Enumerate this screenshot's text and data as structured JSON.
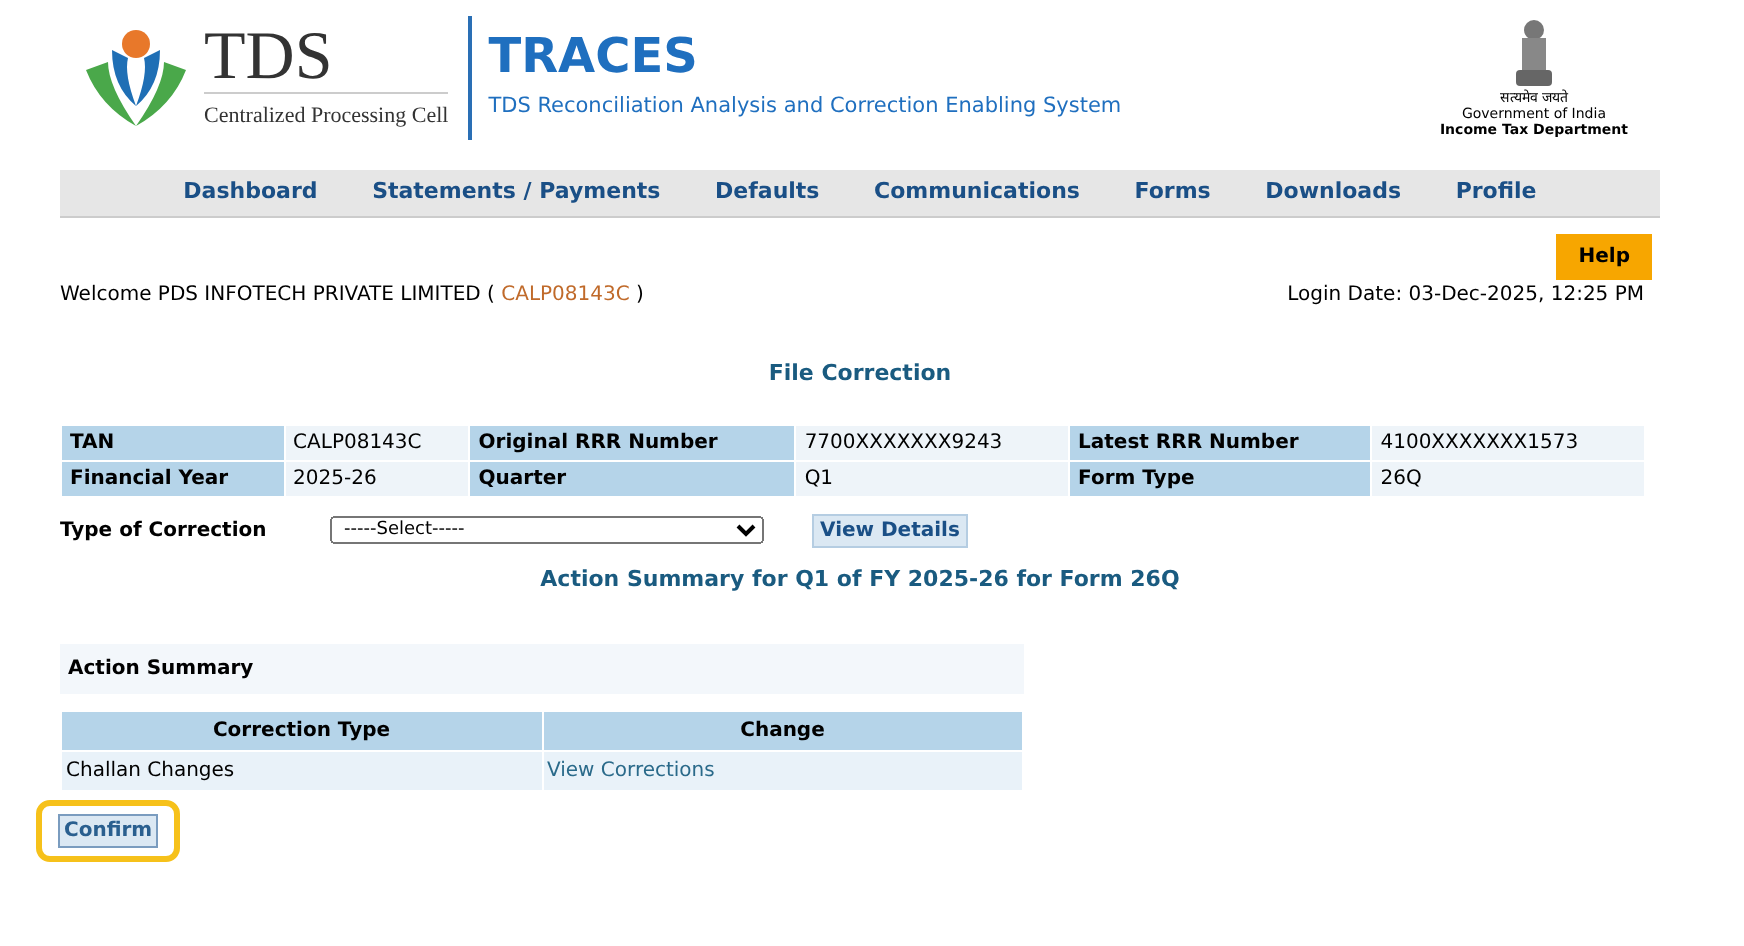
{
  "header": {
    "logo_title": "TDS",
    "logo_subtitle": "Centralized Processing Cell",
    "app_title": "TRACES",
    "app_subtitle": "TDS Reconciliation Analysis and Correction Enabling System",
    "emblem_motto": "सत्यमेव जयते",
    "emblem_line1": "Government of India",
    "emblem_line2": "Income Tax Department"
  },
  "nav": [
    "Dashboard",
    "Statements / Payments",
    "Defaults",
    "Communications",
    "Forms",
    "Downloads",
    "Profile"
  ],
  "help": "Help",
  "welcome": {
    "prefix": "Welcome PDS INFOTECH PRIVATE LIMITED (",
    "tan": "CALP08143C",
    "suffix": ")"
  },
  "login_date": "Login Date: 03-Dec-2025, 12:25 PM",
  "page_title": "File Correction",
  "details": [
    [
      {
        "label": "TAN",
        "value": "CALP08143C"
      },
      {
        "label": "Original RRR Number",
        "value": "7700XXXXXXX9243"
      },
      {
        "label": "Latest RRR Number",
        "value": "4100XXXXXXX1573"
      }
    ],
    [
      {
        "label": "Financial Year",
        "value": "2025-26"
      },
      {
        "label": "Quarter",
        "value": "Q1"
      },
      {
        "label": "Form Type",
        "value": "26Q"
      }
    ]
  ],
  "correction": {
    "label": "Type of Correction",
    "select_value": "-----Select-----",
    "button": "View Details"
  },
  "summary_title": "Action Summary for Q1 of FY 2025-26 for Form 26Q",
  "action_summary": {
    "heading": "Action Summary",
    "columns": [
      "Correction Type",
      "Change"
    ],
    "rows": [
      {
        "type": "Challan Changes",
        "link": "View Corrections"
      }
    ]
  },
  "confirm": {
    "label": "Confirm",
    "highlighted": true
  }
}
